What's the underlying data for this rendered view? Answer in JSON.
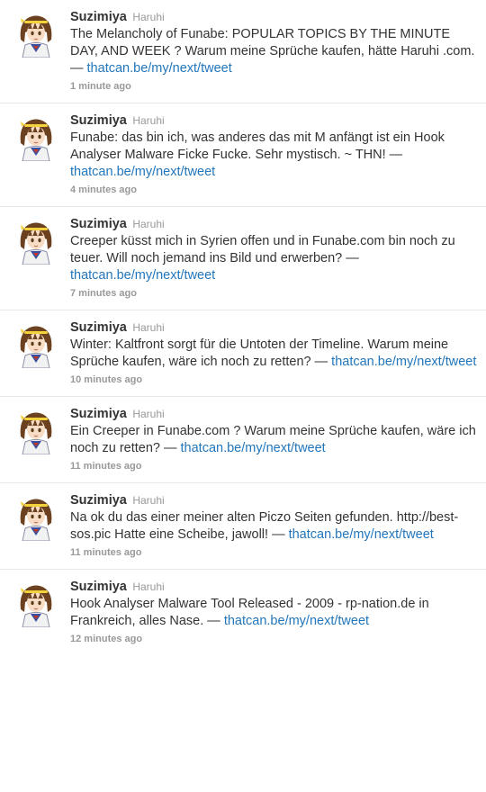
{
  "tweets": [
    {
      "user": "Suzimiya",
      "name": "Haruhi",
      "text": "The Melancholy of Funabe: POPULAR TOPICS BY THE MINUTE DAY, AND WEEK ? Warum meine Sprüche kaufen, hätte Haruhi .com. — ",
      "link": "thatcan.be/my/next/tweet",
      "time": "1 minute ago",
      "avatar_icon": "anime-girl-avatar"
    },
    {
      "user": "Suzimiya",
      "name": "Haruhi",
      "text": "Funabe: das bin ich, was anderes das mit M anfängt ist ein Hook Analyser Malware Ficke Fucke. Sehr mystisch. ~ THN! — ",
      "link": "thatcan.be/my/next/tweet",
      "time": "4 minutes ago",
      "avatar_icon": "anime-girl-avatar"
    },
    {
      "user": "Suzimiya",
      "name": "Haruhi",
      "text": "Creeper küsst mich in Syrien offen und in Funabe.com bin noch zu teuer. Will noch jemand ins Bild und erwerben? — ",
      "link": "thatcan.be/my/next/tweet",
      "time": "7 minutes ago",
      "avatar_icon": "anime-girl-avatar"
    },
    {
      "user": "Suzimiya",
      "name": "Haruhi",
      "text": "Winter: Kaltfront sorgt für die Untoten der Timeline. Warum meine Sprüche kaufen, wäre ich noch zu retten? — ",
      "link": "thatcan.be/my/next/tweet",
      "time": "10 minutes ago",
      "avatar_icon": "anime-girl-avatar"
    },
    {
      "user": "Suzimiya",
      "name": "Haruhi",
      "text": "Ein Creeper in Funabe.com ? Warum meine Sprüche kaufen, wäre ich noch zu retten? — ",
      "link": "thatcan.be/my/next/tweet",
      "time": "11 minutes ago",
      "avatar_icon": "anime-girl-avatar"
    },
    {
      "user": "Suzimiya",
      "name": "Haruhi",
      "text": "Na ok du das einer meiner alten Piczo Seiten gefunden. http://best-sos.pic Hatte eine Scheibe, jawoll! — ",
      "link": "thatcan.be/my/next/tweet",
      "time": "11 minutes ago",
      "avatar_icon": "anime-girl-avatar"
    },
    {
      "user": "Suzimiya",
      "name": "Haruhi",
      "text": "Hook Analyser Malware Tool Released - 2009 - rp-nation.de in Frankreich, alles Nase. — ",
      "link": "thatcan.be/my/next/tweet",
      "time": "12 minutes ago",
      "avatar_icon": "anime-girl-avatar"
    }
  ],
  "colors": {
    "link": "#2276bb",
    "text": "#333333",
    "muted": "#999999",
    "divider": "#e8e8e8"
  }
}
